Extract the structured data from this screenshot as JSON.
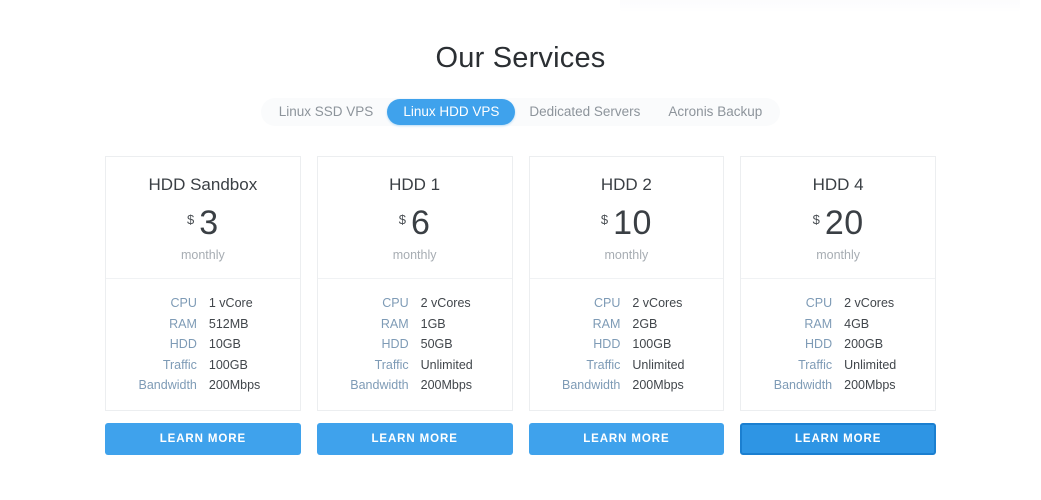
{
  "header": {
    "title": "Our Services"
  },
  "tabs": [
    {
      "label": "Linux SSD VPS",
      "active": false
    },
    {
      "label": "Linux HDD VPS",
      "active": true
    },
    {
      "label": "Dedicated Servers",
      "active": false
    },
    {
      "label": "Acronis Backup",
      "active": false
    }
  ],
  "theme": {
    "accent": "#3fa2ec",
    "accent_focus_border": "#1b7fd0",
    "card_border": "#eceef0",
    "spec_label_color": "#7e9bb6",
    "spec_value_color": "#41464b",
    "title_color": "#2b2f33",
    "muted_text": "#a7adb3"
  },
  "plans": [
    {
      "name": "HDD Sandbox",
      "currency": "$",
      "amount": "3",
      "period": "monthly",
      "cta_label": "LEARN MORE",
      "cta_focused": false,
      "specs": [
        {
          "label": "CPU",
          "value": "1 vCore"
        },
        {
          "label": "RAM",
          "value": "512MB"
        },
        {
          "label": "HDD",
          "value": "10GB"
        },
        {
          "label": "Traffic",
          "value": "100GB"
        },
        {
          "label": "Bandwidth",
          "value": "200Mbps"
        }
      ]
    },
    {
      "name": "HDD 1",
      "currency": "$",
      "amount": "6",
      "period": "monthly",
      "cta_label": "LEARN MORE",
      "cta_focused": false,
      "specs": [
        {
          "label": "CPU",
          "value": "2 vCores"
        },
        {
          "label": "RAM",
          "value": "1GB"
        },
        {
          "label": "HDD",
          "value": "50GB"
        },
        {
          "label": "Traffic",
          "value": "Unlimited"
        },
        {
          "label": "Bandwidth",
          "value": "200Mbps"
        }
      ]
    },
    {
      "name": "HDD 2",
      "currency": "$",
      "amount": "10",
      "period": "monthly",
      "cta_label": "LEARN MORE",
      "cta_focused": false,
      "specs": [
        {
          "label": "CPU",
          "value": "2 vCores"
        },
        {
          "label": "RAM",
          "value": "2GB"
        },
        {
          "label": "HDD",
          "value": "100GB"
        },
        {
          "label": "Traffic",
          "value": "Unlimited"
        },
        {
          "label": "Bandwidth",
          "value": "200Mbps"
        }
      ]
    },
    {
      "name": "HDD 4",
      "currency": "$",
      "amount": "20",
      "period": "monthly",
      "cta_label": "LEARN MORE",
      "cta_focused": true,
      "specs": [
        {
          "label": "CPU",
          "value": "2 vCores"
        },
        {
          "label": "RAM",
          "value": "4GB"
        },
        {
          "label": "HDD",
          "value": "200GB"
        },
        {
          "label": "Traffic",
          "value": "Unlimited"
        },
        {
          "label": "Bandwidth",
          "value": "200Mbps"
        }
      ]
    }
  ]
}
